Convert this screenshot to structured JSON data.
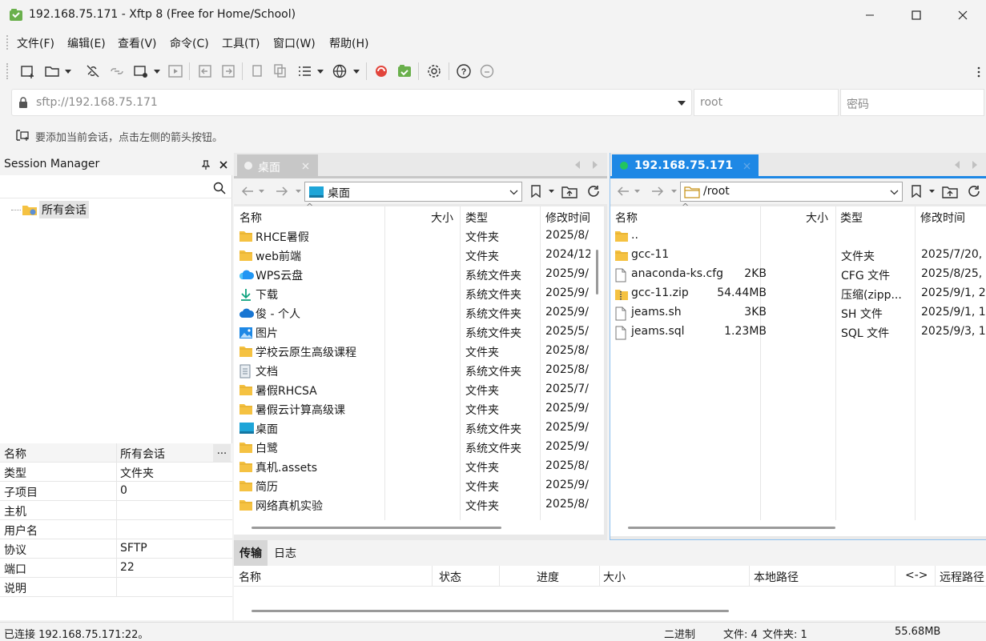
{
  "window": {
    "title": "192.168.75.171 - Xftp 8 (Free for Home/School)"
  },
  "menu": [
    "文件(F)",
    "编辑(E)",
    "查看(V)",
    "命令(C)",
    "工具(T)",
    "窗口(W)",
    "帮助(H)"
  ],
  "address": {
    "url": "sftp://192.168.75.171",
    "user_placeholder": "root",
    "password_placeholder": "密码"
  },
  "hint": "要添加当前会话，点击左侧的箭头按钮。",
  "session_manager": {
    "title": "Session Manager",
    "tree_root": "所有会话",
    "properties": [
      {
        "key": "名称",
        "value": "所有会话"
      },
      {
        "key": "类型",
        "value": "文件夹"
      },
      {
        "key": "子项目",
        "value": "0"
      },
      {
        "key": "主机",
        "value": ""
      },
      {
        "key": "用户名",
        "value": ""
      },
      {
        "key": "协议",
        "value": "SFTP"
      },
      {
        "key": "端口",
        "value": "22"
      },
      {
        "key": "说明",
        "value": ""
      }
    ],
    "more_label": "..."
  },
  "local": {
    "tab_label": "桌面",
    "path": "桌面",
    "columns": {
      "name": "名称",
      "size": "大小",
      "type": "类型",
      "modified": "修改时间"
    },
    "files": [
      {
        "name": "RHCE暑假",
        "size": "",
        "type": "文件夹",
        "modified": "2025/8/",
        "icon": "folder"
      },
      {
        "name": "web前端",
        "size": "",
        "type": "文件夹",
        "modified": "2024/12",
        "icon": "folder"
      },
      {
        "name": "WPS云盘",
        "size": "",
        "type": "系统文件夹",
        "modified": "2025/9/",
        "icon": "cloud-wps"
      },
      {
        "name": "下载",
        "size": "",
        "type": "系统文件夹",
        "modified": "2025/9/",
        "icon": "download"
      },
      {
        "name": "俊 - 个人",
        "size": "",
        "type": "系统文件夹",
        "modified": "2025/9/",
        "icon": "onedrive"
      },
      {
        "name": "图片",
        "size": "",
        "type": "系统文件夹",
        "modified": "2025/5/",
        "icon": "pictures"
      },
      {
        "name": "学校云原生高级课程",
        "size": "",
        "type": "文件夹",
        "modified": "2025/8/",
        "icon": "folder"
      },
      {
        "name": "文档",
        "size": "",
        "type": "系统文件夹",
        "modified": "2025/8/",
        "icon": "document"
      },
      {
        "name": "暑假RHCSA",
        "size": "",
        "type": "文件夹",
        "modified": "2025/7/",
        "icon": "folder"
      },
      {
        "name": "暑假云计算高级课",
        "size": "",
        "type": "文件夹",
        "modified": "2025/9/",
        "icon": "folder"
      },
      {
        "name": "桌面",
        "size": "",
        "type": "系统文件夹",
        "modified": "2025/9/",
        "icon": "desktop"
      },
      {
        "name": "白鹭",
        "size": "",
        "type": "系统文件夹",
        "modified": "2025/9/",
        "icon": "folder"
      },
      {
        "name": "真机.assets",
        "size": "",
        "type": "文件夹",
        "modified": "2025/8/",
        "icon": "folder"
      },
      {
        "name": "简历",
        "size": "",
        "type": "文件夹",
        "modified": "2025/9/",
        "icon": "folder"
      },
      {
        "name": "网络真机实验",
        "size": "",
        "type": "文件夹",
        "modified": "2025/8/",
        "icon": "folder"
      }
    ]
  },
  "remote": {
    "tab_label": "192.168.75.171",
    "path": "/root",
    "columns": {
      "name": "名称",
      "size": "大小",
      "type": "类型",
      "modified": "修改时间"
    },
    "files": [
      {
        "name": "..",
        "size": "",
        "type": "",
        "modified": "",
        "icon": "folder"
      },
      {
        "name": "gcc-11",
        "size": "",
        "type": "文件夹",
        "modified": "2025/7/20,",
        "icon": "folder"
      },
      {
        "name": "anaconda-ks.cfg",
        "size": "2KB",
        "type": "CFG 文件",
        "modified": "2025/8/25,",
        "icon": "file"
      },
      {
        "name": "gcc-11.zip",
        "size": "54.44MB",
        "type": "压缩(zipp...",
        "modified": "2025/9/1, 2",
        "icon": "zip"
      },
      {
        "name": "jeams.sh",
        "size": "3KB",
        "type": "SH 文件",
        "modified": "2025/9/1, 1",
        "icon": "file"
      },
      {
        "name": "jeams.sql",
        "size": "1.23MB",
        "type": "SQL 文件",
        "modified": "2025/9/3, 1",
        "icon": "file"
      }
    ]
  },
  "transfer": {
    "tabs": [
      "传输",
      "日志"
    ],
    "columns": [
      "名称",
      "状态",
      "进度",
      "大小",
      "本地路径",
      "<->",
      "远程路径"
    ]
  },
  "status": {
    "connection": "已连接 192.168.75.171:22。",
    "mode": "二进制",
    "files": "文件: 4",
    "folders": "文件夹: 1",
    "size": "55.68MB"
  },
  "colors": {
    "accent": "#1e88e5",
    "folder": "#f5c242",
    "active_tab": "#1e88e5",
    "connected_dot": "#22c55e"
  }
}
